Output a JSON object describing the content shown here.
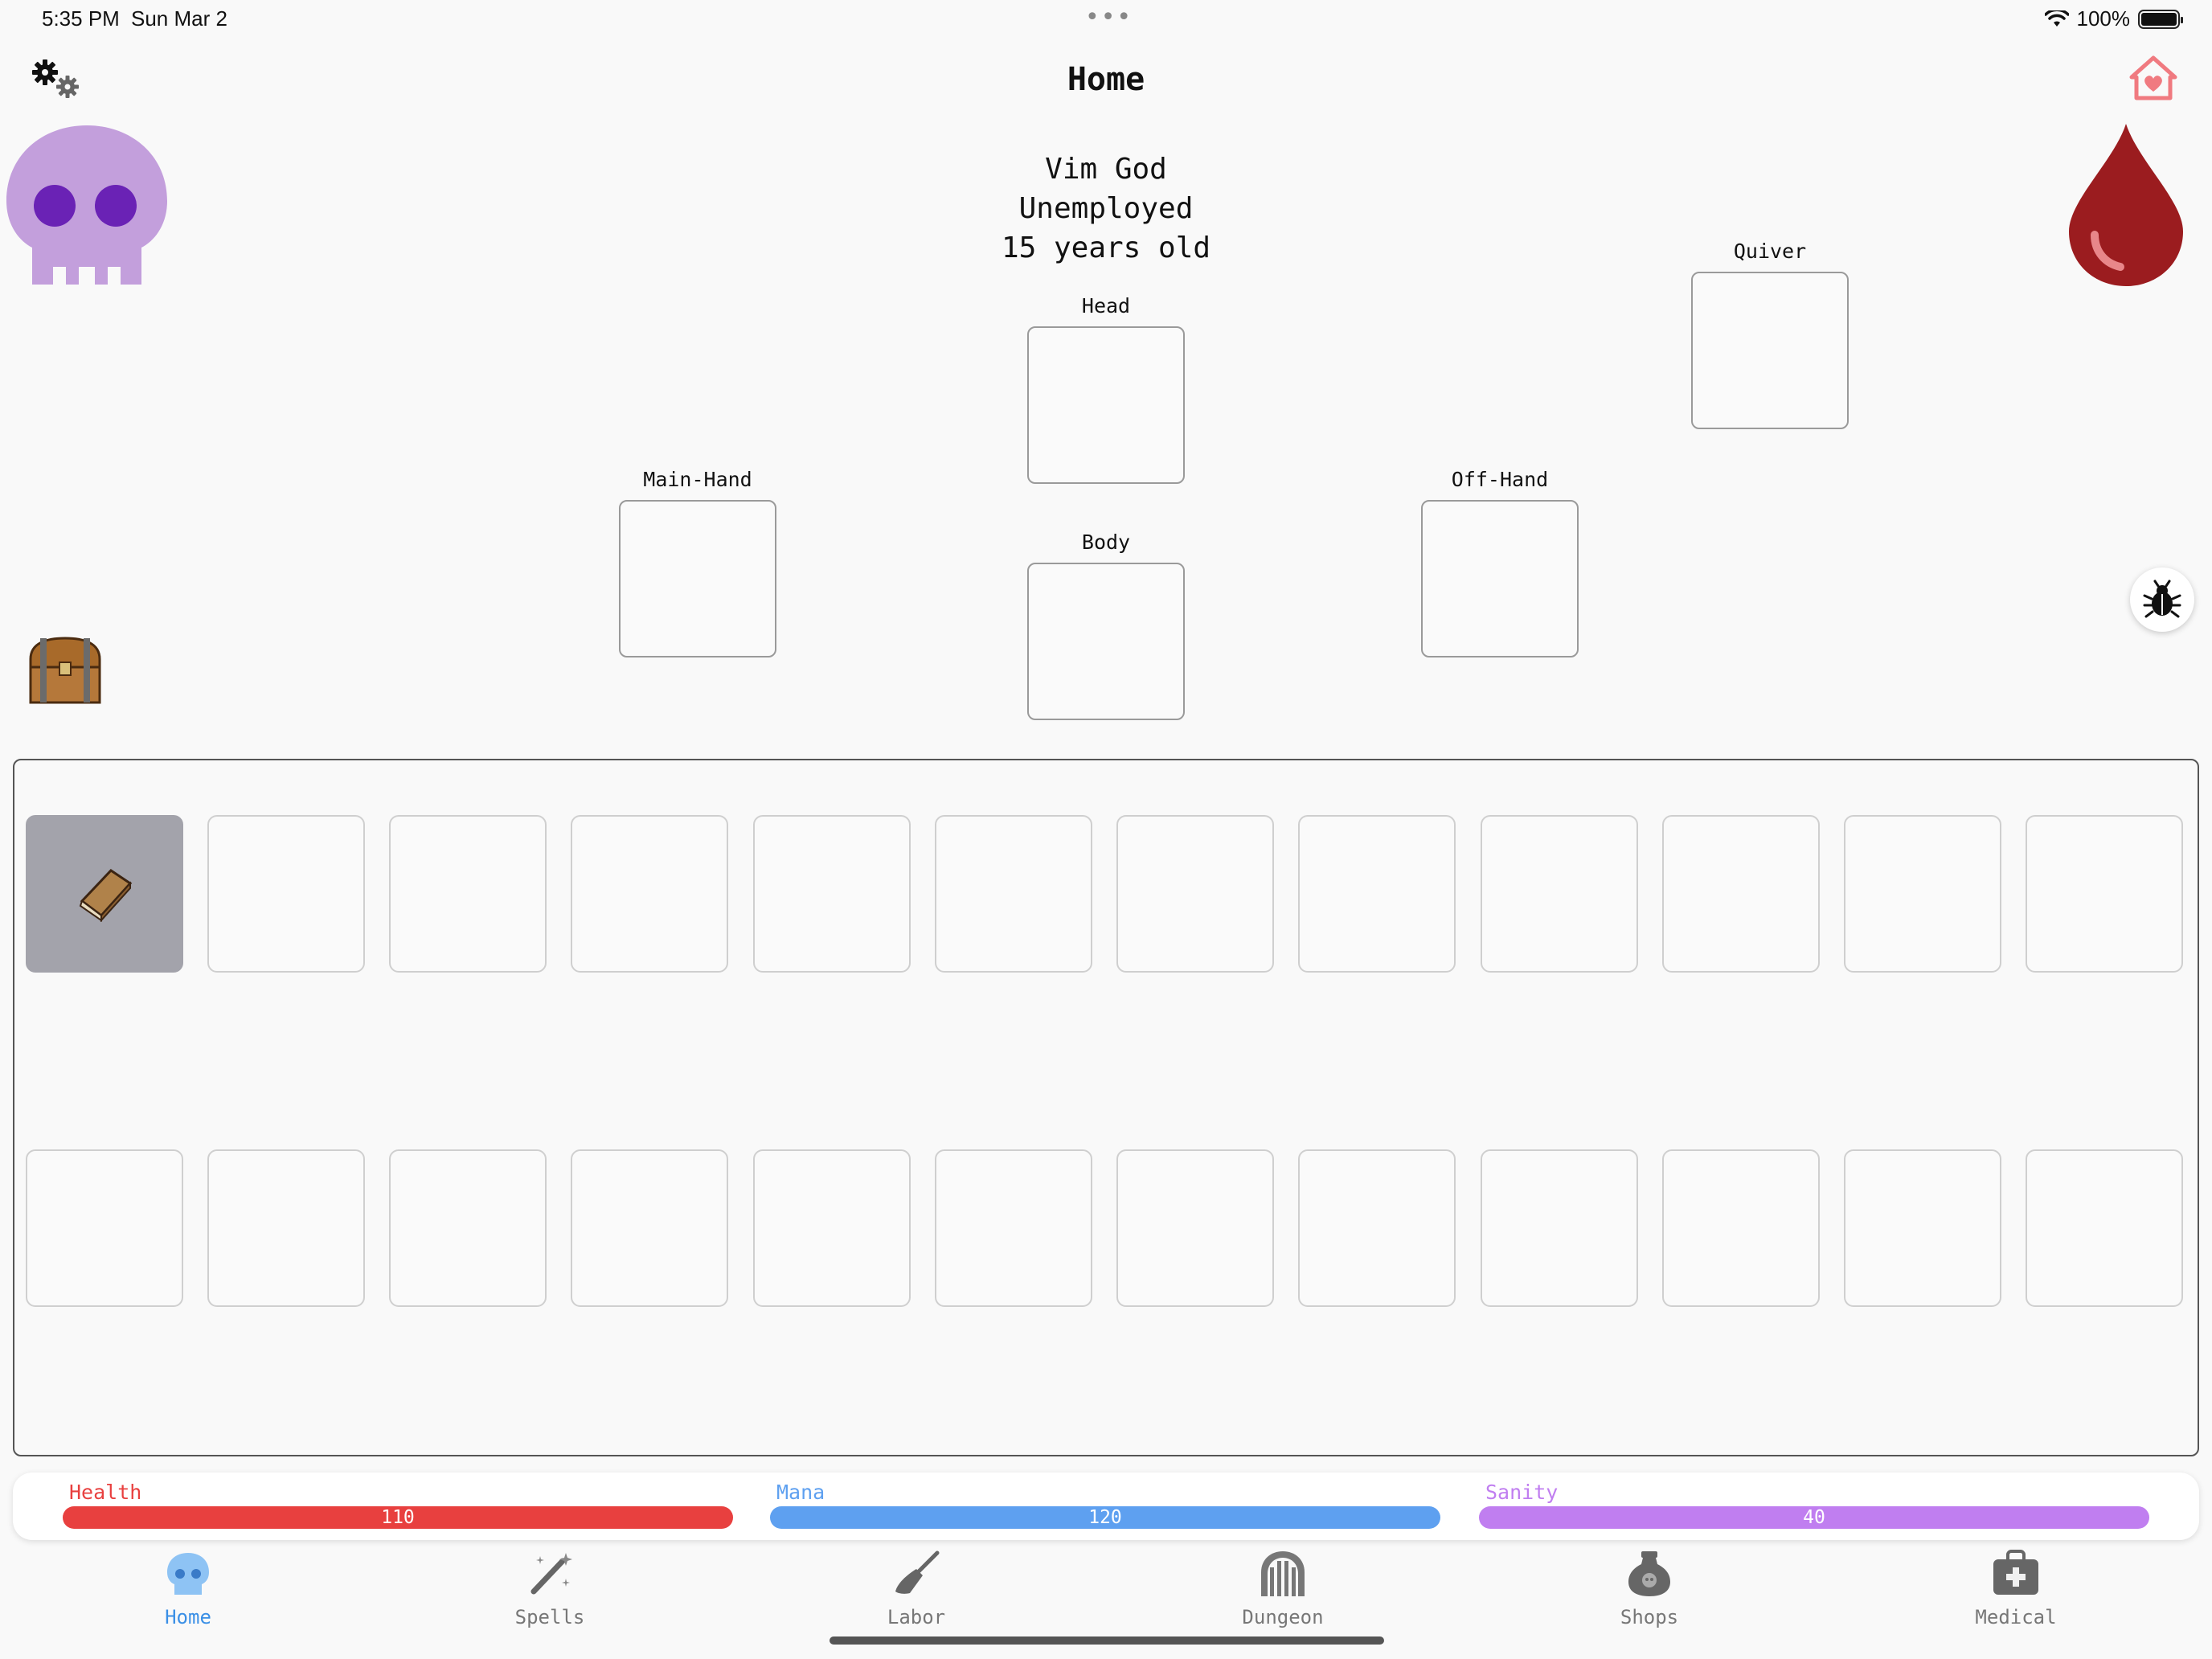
{
  "status_bar": {
    "time": "5:35 PM",
    "date": "Sun Mar 2",
    "battery": "100%"
  },
  "header": {
    "title": "Home"
  },
  "player": {
    "name": "Vim God",
    "job": "Unemployed",
    "age": "15 years old"
  },
  "equipment": {
    "head": "Head",
    "main_hand": "Main-Hand",
    "body": "Body",
    "off_hand": "Off-Hand",
    "quiver": "Quiver"
  },
  "stats": {
    "health": {
      "label": "Health",
      "value": "110",
      "color": "#e8403f"
    },
    "mana": {
      "label": "Mana",
      "value": "120",
      "color": "#5ea0f0"
    },
    "sanity": {
      "label": "Sanity",
      "value": "40",
      "color": "#c07ef0"
    }
  },
  "tabs": [
    {
      "label": "Home",
      "icon": "skull-icon",
      "active": true
    },
    {
      "label": "Spells",
      "icon": "wand-icon"
    },
    {
      "label": "Labor",
      "icon": "broom-icon"
    },
    {
      "label": "Dungeon",
      "icon": "dungeon-gate-icon"
    },
    {
      "label": "Shops",
      "icon": "potion-bag-icon"
    },
    {
      "label": "Medical",
      "icon": "medkit-icon"
    }
  ],
  "icons": {
    "settings": "gears-icon",
    "home_heart": "house-heart-icon",
    "avatar": "purple-skull-icon",
    "blood": "blood-drop-icon",
    "chest": "treasure-chest-icon",
    "debug": "bug-icon",
    "inventory_item": "book-icon"
  },
  "colors": {
    "accent": "#3a8fe6",
    "skull": "#c39fdc",
    "skull_eyes": "#6a22b5",
    "blood": "#9b1c1f"
  }
}
